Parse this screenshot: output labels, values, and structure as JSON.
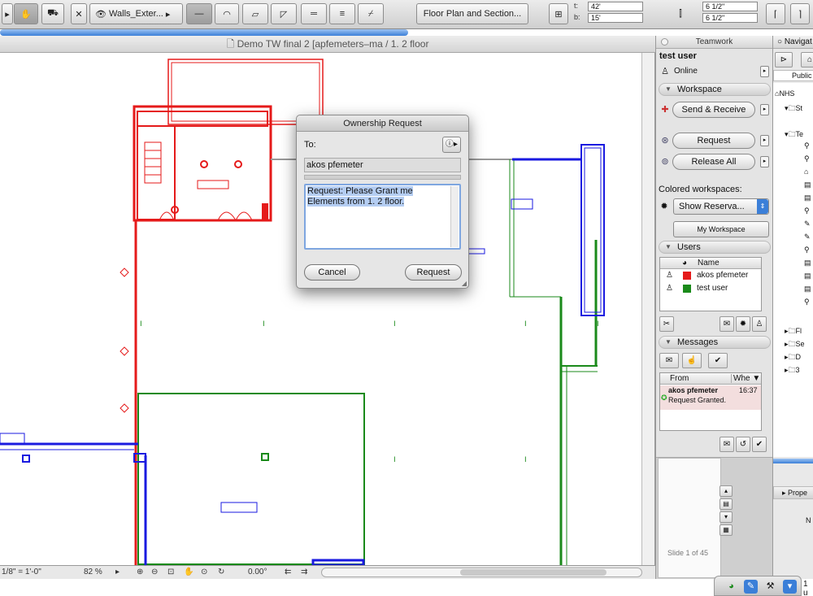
{
  "toolbar": {
    "layer_select": "Walls_Exter...",
    "view_combo": "Floor Plan and Section...",
    "field_t_label": "t:",
    "field_t_value": "42'",
    "field_b_label": "b:",
    "field_b_value": "15'",
    "field_r1": "6 1/2\"",
    "field_r2": "6 1/2\""
  },
  "window": {
    "title": "Demo TW final 2  [apfemeters–ma / 1. 2 floor"
  },
  "statusbar": {
    "scale": "1/8\"  =  1'-0\"",
    "zoom": "82 %",
    "angle": "0.00°"
  },
  "dialog": {
    "title": "Ownership Request",
    "to_label": "To:",
    "recipient": "akos pfemeter",
    "message_line1": "Request: Please Grant me",
    "message_line2": "Elements from 1. 2 floor.",
    "cancel_label": "Cancel",
    "request_label": "Request"
  },
  "teamwork": {
    "title": "Teamwork",
    "user_name": "test user",
    "status": "Online",
    "workspace_section": "Workspace",
    "send_receive_label": "Send & Receive",
    "request_label": "Request",
    "release_all_label": "Release All",
    "colored_workspaces_label": "Colored workspaces:",
    "colored_workspaces_value": "Show Reserva...",
    "my_workspace_label": "My Workspace",
    "users_section": "Users",
    "users_header_name": "Name",
    "users": [
      {
        "name": "akos pfemeter",
        "color": "#e51a1a"
      },
      {
        "name": "test user",
        "color": "#1a8a1a"
      }
    ],
    "messages_section": "Messages",
    "messages_header_from": "From",
    "messages_header_when": "Whe",
    "messages": [
      {
        "from": "akos pfemeter",
        "time": "16:37",
        "text": "Request Granted."
      }
    ],
    "slide_label": "Slide 1 of 45"
  },
  "navigator": {
    "title": "Navigat",
    "public_label": "Public",
    "tree": [
      "NHS",
      "St",
      "Te",
      "Fl",
      "Se",
      "D",
      "3"
    ],
    "properties_label": "Prope",
    "extra_label": "N"
  },
  "dock": {
    "label": "1 u"
  },
  "colors": {
    "red_owner": "#e51a1a",
    "green_owner": "#1a8a1a",
    "blue_owner": "#1a1ae0",
    "selection": "#b4cdf2"
  }
}
